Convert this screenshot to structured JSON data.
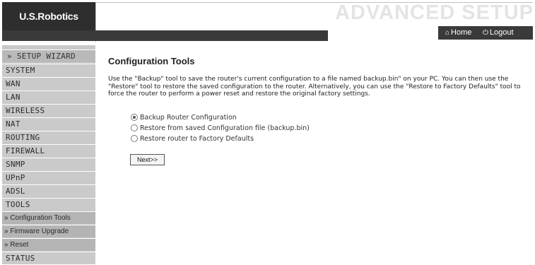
{
  "header": {
    "logo_text": "U.S.Robotics",
    "logo_mark": "·",
    "title": "ADVANCED SETUP",
    "home_label": "Home",
    "logout_label": "Logout",
    "home_icon": "home-icon",
    "logout_icon": "power-icon"
  },
  "sidebar": {
    "items": [
      {
        "label": "» SETUP WIZARD",
        "type": "wizard"
      },
      {
        "label": "SYSTEM",
        "type": "main"
      },
      {
        "label": "WAN",
        "type": "main"
      },
      {
        "label": "LAN",
        "type": "main"
      },
      {
        "label": "WIRELESS",
        "type": "main"
      },
      {
        "label": "NAT",
        "type": "main"
      },
      {
        "label": "ROUTING",
        "type": "main"
      },
      {
        "label": "FIREWALL",
        "type": "main"
      },
      {
        "label": "SNMP",
        "type": "main"
      },
      {
        "label": "UPnP",
        "type": "main"
      },
      {
        "label": "ADSL",
        "type": "main"
      },
      {
        "label": "TOOLS",
        "type": "main"
      },
      {
        "label": "» Configuration Tools",
        "type": "sub"
      },
      {
        "label": "» Firmware Upgrade",
        "type": "sub"
      },
      {
        "label": "» Reset",
        "type": "sub"
      },
      {
        "label": "STATUS",
        "type": "main"
      }
    ]
  },
  "main": {
    "title": "Configuration Tools",
    "intro": "Use the \"Backup\" tool to save the router's current configuration to a file named backup.bin\" on your PC. You can then use the \"Restore\" tool to restore the saved configuration to the router.  Alternatively, you can use the \"Restore to Factory Defaults\" tool to force the router to perform a power reset and restore the original factory settings.",
    "options": [
      {
        "label": "Backup Router Configuration",
        "selected": true
      },
      {
        "label": "Restore from saved Configuration file (backup.bin)",
        "selected": false
      },
      {
        "label": "Restore router to Factory Defaults",
        "selected": false
      }
    ],
    "next_label": "Next>>"
  },
  "colors": {
    "dark_bar": "#3a3a3a",
    "sidebar_bg": "#c8c8c8",
    "title_watermark": "#e4e4e4"
  }
}
